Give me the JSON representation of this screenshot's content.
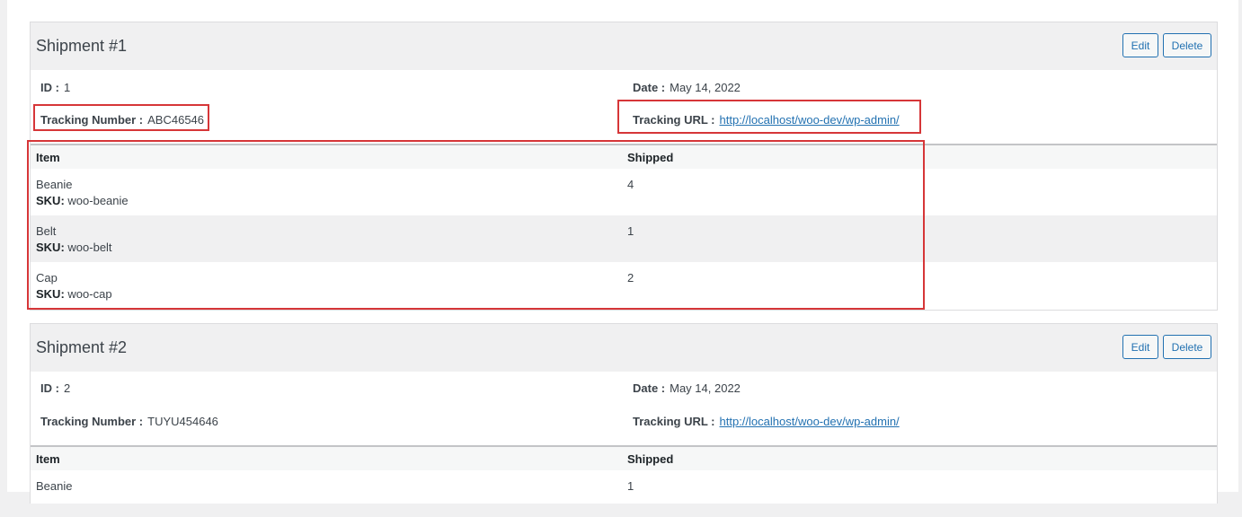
{
  "shipments": [
    {
      "title": "Shipment #1",
      "edit_label": "Edit",
      "delete_label": "Delete",
      "id_label": "ID :",
      "id_value": "1",
      "date_label": "Date :",
      "date_value": "May 14, 2022",
      "tracking_number_label": "Tracking Number :",
      "tracking_number_value": "ABC46546",
      "tracking_url_label": "Tracking URL :",
      "tracking_url_value": "http://localhost/woo-dev/wp-admin/",
      "columns": {
        "item": "Item",
        "shipped": "Shipped"
      },
      "sku_label": "SKU:",
      "items": [
        {
          "name": "Beanie",
          "sku": "woo-beanie",
          "shipped": "4"
        },
        {
          "name": "Belt",
          "sku": "woo-belt",
          "shipped": "1"
        },
        {
          "name": "Cap",
          "sku": "woo-cap",
          "shipped": "2"
        }
      ]
    },
    {
      "title": "Shipment #2",
      "edit_label": "Edit",
      "delete_label": "Delete",
      "id_label": "ID :",
      "id_value": "2",
      "date_label": "Date :",
      "date_value": "May 14, 2022",
      "tracking_number_label": "Tracking Number :",
      "tracking_number_value": "TUYU454646",
      "tracking_url_label": "Tracking URL :",
      "tracking_url_value": "http://localhost/woo-dev/wp-admin/",
      "columns": {
        "item": "Item",
        "shipped": "Shipped"
      },
      "items": [
        {
          "name": "Beanie",
          "shipped": "1"
        }
      ]
    }
  ],
  "colors": {
    "accent": "#2271b1",
    "highlight": "#d63638"
  }
}
